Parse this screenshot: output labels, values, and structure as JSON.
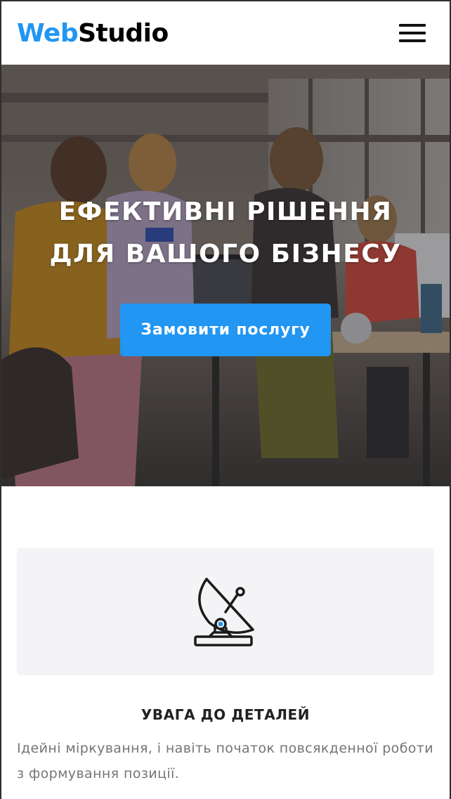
{
  "header": {
    "logo_accent": "Web",
    "logo_rest": "Studio",
    "menu_icon": "hamburger-menu-icon"
  },
  "hero": {
    "title": "ЕФЕКТИВНІ РІШЕННЯ ДЛЯ ВАШОГО БІЗНЕСУ",
    "cta_label": "Замовити послугу"
  },
  "feature": {
    "icon": "satellite-dish-icon",
    "title": "УВАГА ДО ДЕТАЛЕЙ",
    "text": "Ідейні міркування, і навіть початок повсякденної роботи з формування позиції."
  },
  "colors": {
    "accent": "#2196f3",
    "text_dark": "#212121",
    "text_muted": "#757575",
    "card_bg": "#f4f4f7"
  }
}
